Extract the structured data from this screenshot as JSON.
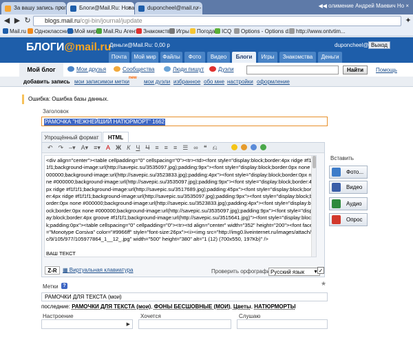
{
  "browser": {
    "tabs": [
      {
        "label": "За вашу запись проголосо..."
      },
      {
        "label": "Блоги@Mail.Ru: Новая за..."
      },
      {
        "label": "duponcheel@mail.ru - По..."
      }
    ],
    "window_text": "◀◀ олимение Андрей Маевич Но ×",
    "url_host": "blogs.mail.ru",
    "url_path": "/cgi-bin/journal/jupdate",
    "bookmarks": [
      "Mail.ru",
      "Одноклассники",
      "Мой мир",
      "Mail.Ru Агент",
      "Знакомства",
      "Игры",
      "Погода",
      "ICQ",
      "Options - Options d...",
      "http://www.ontvtim..."
    ]
  },
  "mail_header": {
    "logo_a": "БЛОГИ",
    "logo_b": "@mail.ru",
    "money": "Деньги@Mail.Ru: 0,00 р",
    "user": "duponcheel@mail.ru",
    "exit": "Выход",
    "tabs": [
      "Почта",
      "Мой мир",
      "Файлы",
      "Фото",
      "Видео",
      "Блоги",
      "Игры",
      "Знакомства",
      "Деньги"
    ]
  },
  "blog_nav": {
    "my_blog": "Мой блог",
    "friends": "Мои друзья",
    "communities": "Сообщества",
    "people": "Люди пишут",
    "ducks": "Дуэли",
    "search_btn": "Найти",
    "help": "Помощь",
    "sub": [
      "добавить запись",
      "мои записи",
      "мои метки",
      "мои дуэли",
      "избранное",
      "обо мне",
      "настройки",
      "оформление"
    ],
    "new_badge": "new"
  },
  "form": {
    "error": "Ошибка: Ошибка базы данных.",
    "title_label": "Заголовок",
    "title_value": "РАМОЧКА \"НЕЖНЕЙШИЙ НАТЮРМОРТ\" 1662",
    "tab_simple": "Упрощённый формат",
    "tab_html": "HTML",
    "html_body": "<div align=\"center\"><table cellpadding=\"0\" cellspacing=\"0\"><tr><td><font style=\"display:block;border:4px ridge #f1f1f1;background-image:url(http://savepic.su/3535097.jpg);padding:9px\"><font style=\"display:block;border:0px none #000000;background-image:url(http://savepic.su/3523833.jpg);padding:4px\"><font style=\"display:block;border:0px none #000000;background-image:url(http://savepic.su/3535097.jpg);padding:9px\"><font style=\"display:block;border:4px ridge #f1f1f1;background-image:url(http://savepic.su/3517689.jpg);padding:45px\"><font style=\"display:block;border:4px ridge #f1f1f1;background-image:url(http://savepic.su/3535097.jpg);padding:9px\"><font style=\"display:block;border:0px none #000000;background-image:url(http://savepic.su/3523833.jpg);padding:4px\"><font style=\"display:block;border:0px none #000000;background-image:url(http://savepic.su/3535097.jpg);padding:9px\"><font style=\"display:block;border:4px groove #f1f1f1;background-image:url(http://savepic.su/3515641.jpg)\"><font style=\"display:block;padding:0px\"><table cellspacing=\"0\" cellpadding=\"0\"><tr><td align=\"center\" width=\"352\" height=\"200\"><font face=\"Monotype Corsiva\" color=\"#9966ff\" style=\"font-size:26px\"><i><img src=\"http://img0.liveinternet.ru/images/attach/c/9/105/977/105977864_1__12_.jpg\" width=\"500\" height=\"380\" alt=\"1 (12) (700x550, 197Kb)\" />",
    "html_tail": "ВАШ ТЕКСТ",
    "zr": "Z-R",
    "virtual_kb": "Виртуальная клавиатура",
    "spell_label": "Проверить орфографию",
    "spell_lang": "Русский язык",
    "insert_label": "Вставить",
    "insert_buttons": [
      "Фото...",
      "Видео",
      "Аудио",
      "Опрос"
    ],
    "tags_label": "Метки",
    "tags_help": "?",
    "tags_value": "РАМОЧКИ ДЛЯ ТЕКСТА (мои)",
    "last_label": "последние:",
    "last_tags": [
      "РАМОЧКИ ДЛЯ ТЕКСТА (мои)",
      "ФОНЫ БЕСШОВНЫЕ (МОИ)",
      "Цветы",
      "НАТЮРМОРТЫ"
    ],
    "mood_label": "Настроение",
    "want_label": "Хочется",
    "listen_label": "Слушаю"
  }
}
